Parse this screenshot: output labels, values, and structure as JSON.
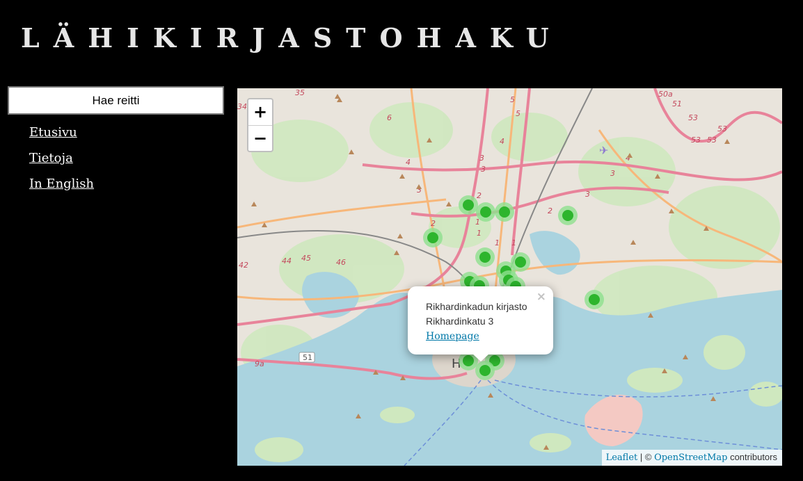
{
  "header": {
    "title": "LÄHIKIRJASTOHAKU"
  },
  "sidebar": {
    "route_button": "Hae reitti",
    "nav": [
      {
        "label": "Etusivu"
      },
      {
        "label": "Tietoja"
      },
      {
        "label": "In English"
      }
    ]
  },
  "map": {
    "zoom_in": "+",
    "zoom_out": "−",
    "popup": {
      "name": "Rikhardinkadun kirjasto",
      "address": "Rikhardinkatu 3",
      "link": "Homepage",
      "close": "×"
    },
    "attribution": {
      "leaflet": "Leaflet",
      "sep": " | © ",
      "osm": "OpenStreetMap",
      "suffix": " contributors"
    },
    "road_labels": [
      "35",
      "6",
      "5",
      "50a",
      "51",
      "53",
      "53",
      "53",
      "53",
      "4",
      "4",
      "4",
      "3",
      "3",
      "3",
      "3",
      "3",
      "2",
      "2",
      "2",
      "1",
      "1",
      "1",
      "1",
      "45",
      "44",
      "46",
      "42",
      "9a",
      "51",
      "34",
      "5"
    ],
    "city_label": "H",
    "colors": {
      "marker": "#2db52d",
      "marker_halo": "#8fe08f",
      "water": "#aad3df",
      "land": "#e9e4dc",
      "green": "#c8e6b8",
      "motorway": "#e8839a",
      "trunk": "#f7b77a"
    }
  }
}
